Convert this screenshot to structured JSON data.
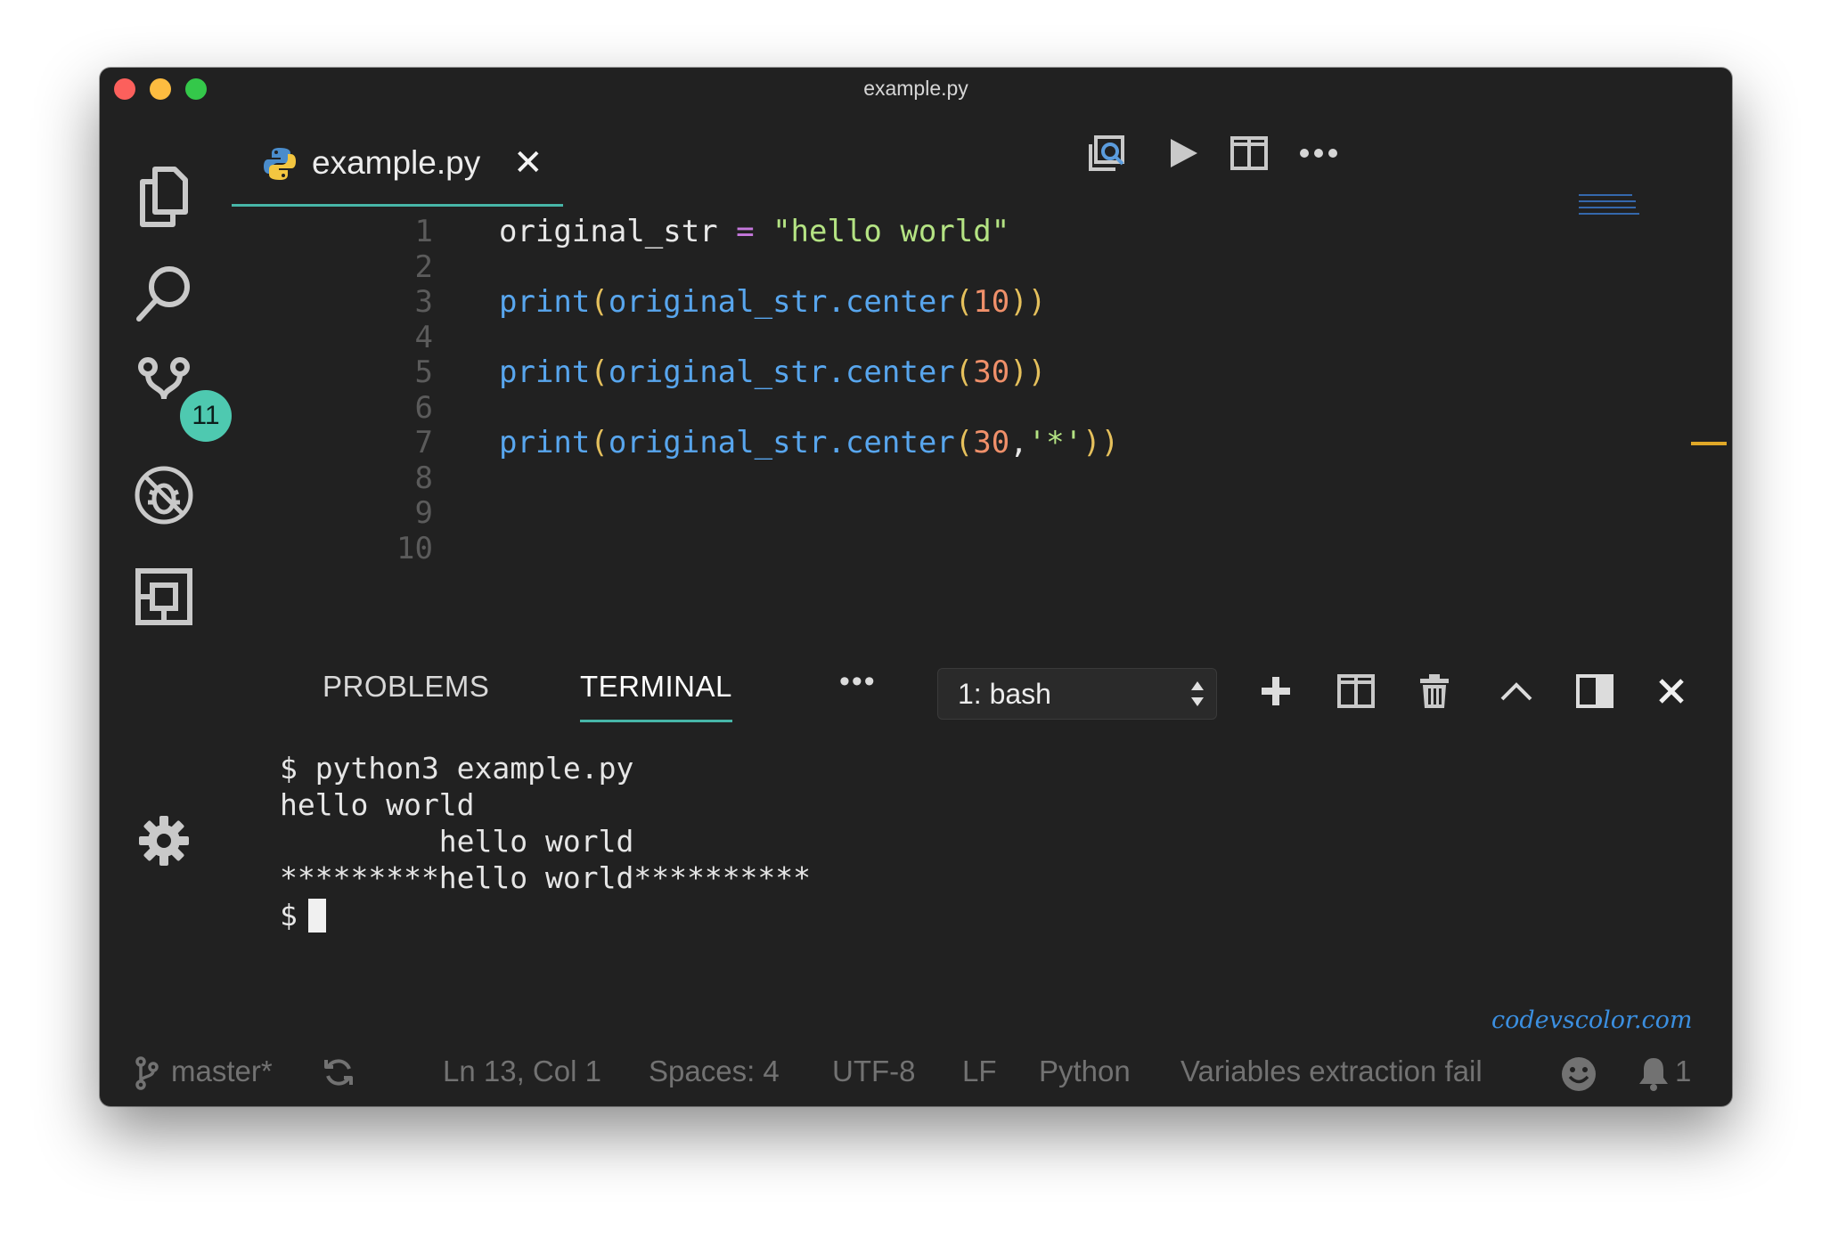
{
  "window": {
    "title": "example.py"
  },
  "activity_bar": {
    "items": [
      {
        "icon": "files-icon"
      },
      {
        "icon": "search-icon"
      },
      {
        "icon": "source-control-icon",
        "badge": "11"
      },
      {
        "icon": "debug-icon"
      },
      {
        "icon": "extensions-icon"
      }
    ],
    "settings_icon": "gear-icon"
  },
  "editor": {
    "tab": {
      "label": "example.py",
      "icon": "python-icon",
      "close": "✕"
    },
    "actions": [
      "open-preview-icon",
      "run-icon",
      "split-editor-icon",
      "more-icon"
    ],
    "lines": [
      {
        "n": "1",
        "tokens": [
          {
            "t": "original_str ",
            "c": ""
          },
          {
            "t": "=",
            "c": "tok-op"
          },
          {
            "t": " ",
            "c": ""
          },
          {
            "t": "\"hello world\"",
            "c": "tok-str"
          }
        ]
      },
      {
        "n": "2",
        "tokens": []
      },
      {
        "n": "3",
        "tokens": [
          {
            "t": "print",
            "c": "tok-fn"
          },
          {
            "t": "(",
            "c": "tok-par"
          },
          {
            "t": "original_str.center",
            "c": "tok-fn"
          },
          {
            "t": "(",
            "c": "tok-par"
          },
          {
            "t": "10",
            "c": "tok-num"
          },
          {
            "t": "))",
            "c": "tok-par"
          }
        ]
      },
      {
        "n": "4",
        "tokens": []
      },
      {
        "n": "5",
        "tokens": [
          {
            "t": "print",
            "c": "tok-fn"
          },
          {
            "t": "(",
            "c": "tok-par"
          },
          {
            "t": "original_str.center",
            "c": "tok-fn"
          },
          {
            "t": "(",
            "c": "tok-par"
          },
          {
            "t": "30",
            "c": "tok-num"
          },
          {
            "t": "))",
            "c": "tok-par"
          }
        ]
      },
      {
        "n": "6",
        "tokens": []
      },
      {
        "n": "7",
        "tokens": [
          {
            "t": "print",
            "c": "tok-fn"
          },
          {
            "t": "(",
            "c": "tok-par"
          },
          {
            "t": "original_str.center",
            "c": "tok-fn"
          },
          {
            "t": "(",
            "c": "tok-par"
          },
          {
            "t": "30",
            "c": "tok-num"
          },
          {
            "t": ",",
            "c": ""
          },
          {
            "t": "'*'",
            "c": "tok-str"
          },
          {
            "t": "))",
            "c": "tok-par"
          }
        ]
      },
      {
        "n": "8",
        "tokens": []
      },
      {
        "n": "9",
        "tokens": []
      },
      {
        "n": "10",
        "tokens": []
      }
    ]
  },
  "panel": {
    "tabs": [
      {
        "label": "PROBLEMS"
      },
      {
        "label": "TERMINAL"
      }
    ],
    "more": "•••",
    "terminal_select": {
      "value": "1: bash"
    },
    "actions": [
      "add-icon",
      "split-terminal-icon",
      "trash-icon",
      "maximize-icon",
      "toggle-panel-icon",
      "close-icon"
    ],
    "terminal_lines": [
      "$ python3 example.py",
      "hello world",
      "         hello world",
      "*********hello world**********"
    ],
    "prompt": "$"
  },
  "watermark": "codevscolor.com",
  "status_bar": {
    "branch": "master*",
    "position": "Ln 13, Col 1",
    "spaces": "Spaces: 4",
    "encoding": "UTF-8",
    "eol": "LF",
    "language": "Python",
    "message": "Variables extraction fail",
    "notifications": "1"
  },
  "colors": {
    "accent": "#47b6a8",
    "badge": "#4ec9b0",
    "background": "#212121"
  }
}
